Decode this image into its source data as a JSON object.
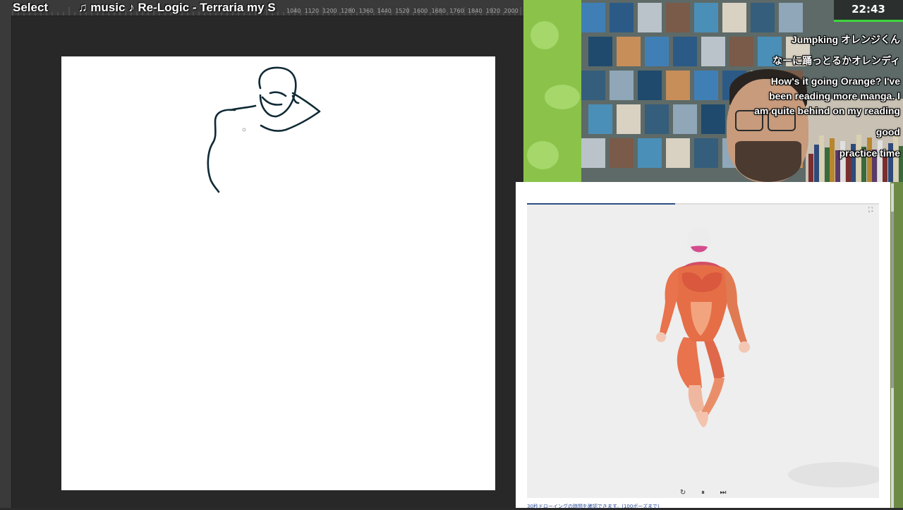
{
  "overlay": {
    "tool_label": "Select",
    "music_text": "♫ music ♪ Re-Logic - Terraria my S"
  },
  "ruler": {
    "top_labels": [
      "1040",
      "1120",
      "1200",
      "1280",
      "1360",
      "1440",
      "1520",
      "1600",
      "1680",
      "1760",
      "1840",
      "1920",
      "2000"
    ]
  },
  "timer": "22:43",
  "chat": [
    "Jumpking オレンジくん",
    "なーに踊っとるかオレンディ",
    "How's it going Orange? I've",
    "been reading more manga. I",
    "am quite behind on my reading",
    "good",
    "practice time"
  ],
  "reference": {
    "progress_fraction": 0.42,
    "controls": {
      "restart": "↻",
      "pause": "⏸",
      "skip": "⏭"
    },
    "caption": "30秒ドローイングの時間を確認できます。(100ポーズまで)"
  },
  "icons": {
    "expand": "expand-icon",
    "restart": "restart-icon",
    "pause": "pause-icon",
    "skip": "skip-icon"
  },
  "colors": {
    "sketch_stroke": "#0f2a35",
    "timer_accent": "#3ed43e",
    "progress": "#2f4f86",
    "muscle": "#e8734c"
  }
}
